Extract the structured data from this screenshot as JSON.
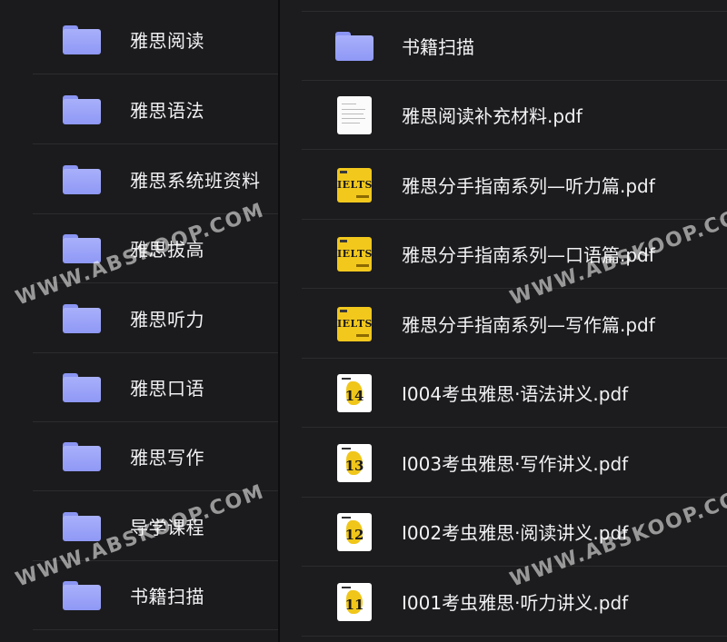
{
  "left_pane": {
    "folders": [
      {
        "label": "雅思阅读"
      },
      {
        "label": "雅思语法"
      },
      {
        "label": "雅思系统班资料"
      },
      {
        "label": "雅思拔高"
      },
      {
        "label": "雅思听力"
      },
      {
        "label": "雅思口语"
      },
      {
        "label": "雅思写作"
      },
      {
        "label": "导学课程"
      },
      {
        "label": "书籍扫描"
      }
    ]
  },
  "right_pane": {
    "items": [
      {
        "label": "书籍扫描",
        "kind": "folder"
      },
      {
        "label": "雅思阅读补充材料.pdf",
        "kind": "doc"
      },
      {
        "label": "雅思分手指南系列—听力篇.pdf",
        "kind": "ielts",
        "thumb_text": "IELTS"
      },
      {
        "label": "雅思分手指南系列—口语篇.pdf",
        "kind": "ielts",
        "thumb_text": "IELTS"
      },
      {
        "label": "雅思分手指南系列—写作篇.pdf",
        "kind": "ielts",
        "thumb_text": "IELTS"
      },
      {
        "label": "I004考虫雅思·语法讲义.pdf",
        "kind": "num",
        "thumb_text": "14"
      },
      {
        "label": "I003考虫雅思·写作讲义.pdf",
        "kind": "num",
        "thumb_text": "13"
      },
      {
        "label": "I002考虫雅思·阅读讲义.pdf",
        "kind": "num",
        "thumb_text": "12"
      },
      {
        "label": "I001考虫雅思·听力讲义.pdf",
        "kind": "num",
        "thumb_text": "11"
      }
    ]
  },
  "watermark": {
    "text": "WWW.ABSKOOP.COM"
  },
  "colors": {
    "folder": "#9aa3f8",
    "ielts_yellow": "#f2c81d",
    "background": "#1a1a1c"
  }
}
